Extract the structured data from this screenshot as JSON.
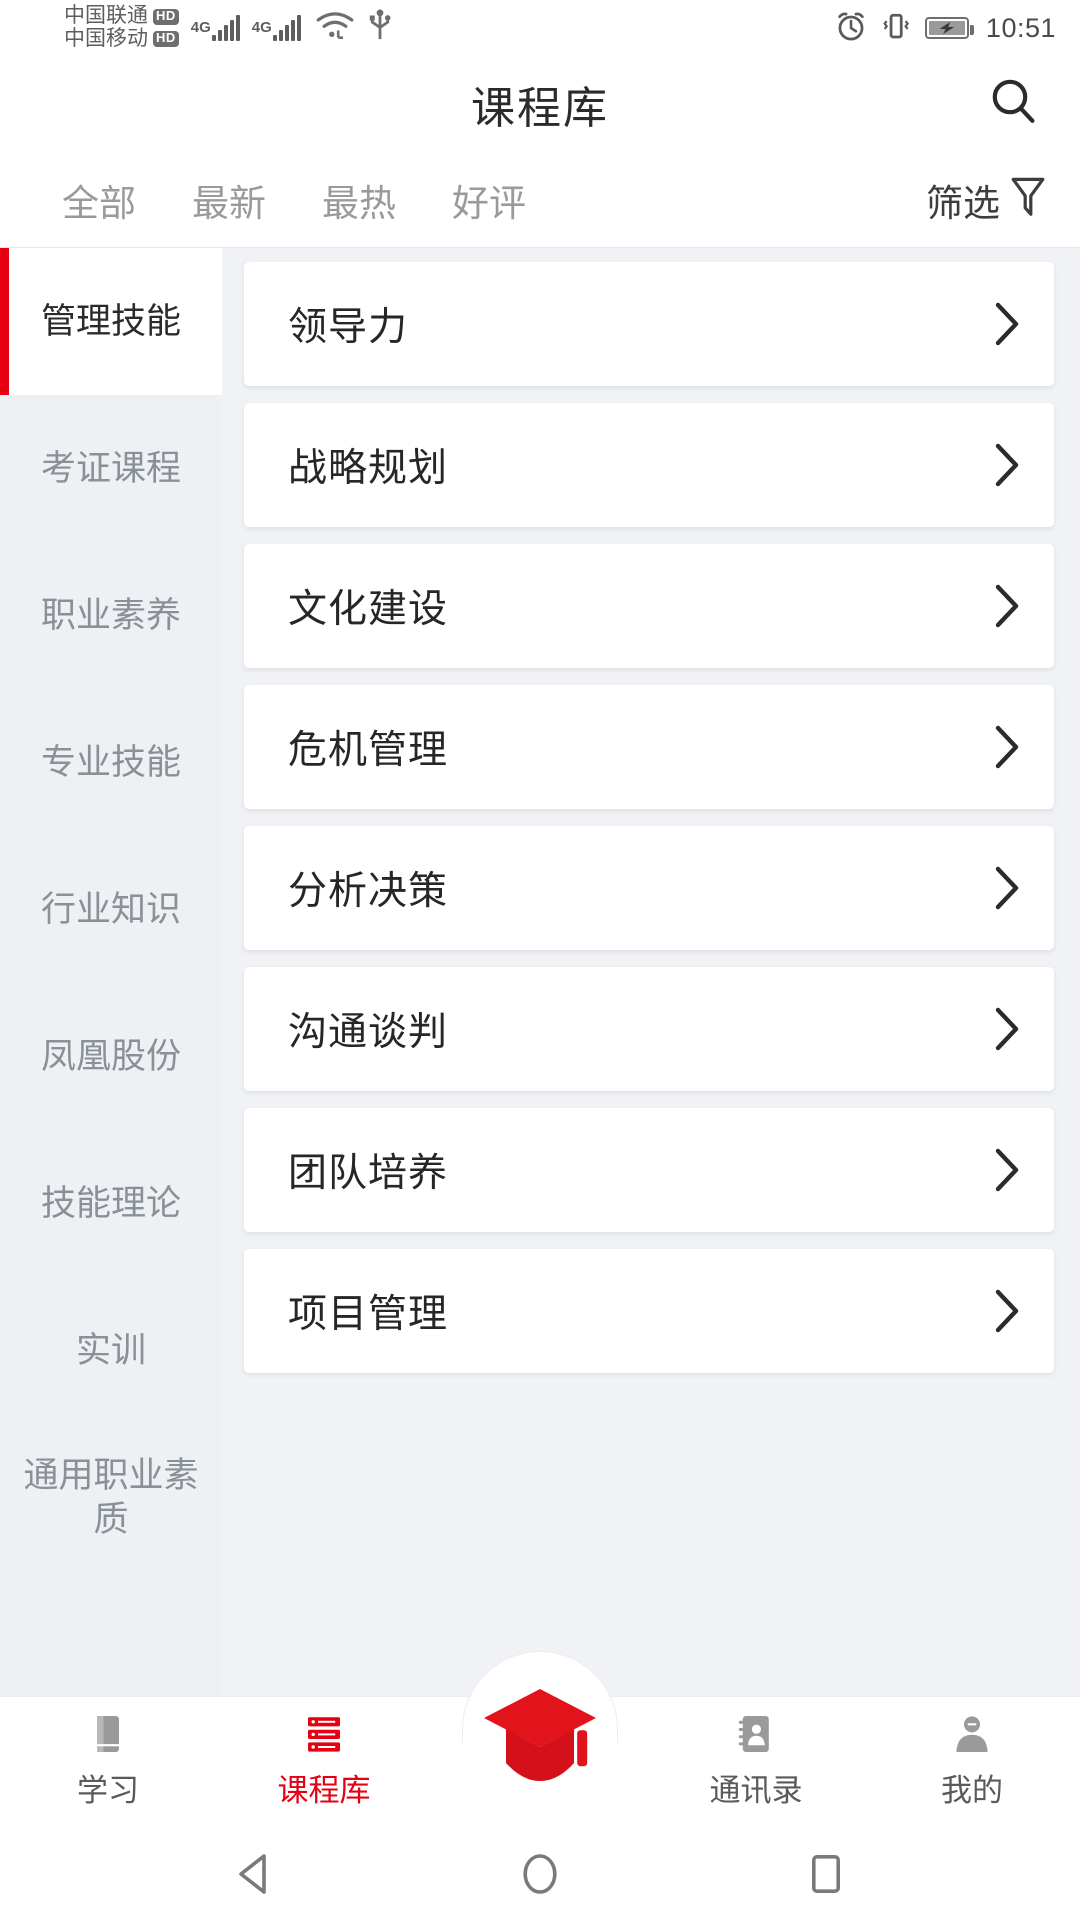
{
  "status_bar": {
    "carriers": [
      {
        "name": "中国联通",
        "badge": "HD",
        "network": "4G"
      },
      {
        "name": "中国移动",
        "badge": "HD",
        "network": "4G"
      }
    ],
    "wifi_icon": "wifi-icon",
    "usb_icon": "usb-icon",
    "alarm_icon": "alarm-clock-icon",
    "vibrate_icon": "vibrate-icon",
    "battery_icon": "battery-charging-icon",
    "time": "10:51"
  },
  "header": {
    "title": "课程库",
    "search_icon": "search-icon"
  },
  "tabs": {
    "items": [
      {
        "label": "全部",
        "active": true
      },
      {
        "label": "最新",
        "active": false
      },
      {
        "label": "最热",
        "active": false
      },
      {
        "label": "好评",
        "active": false
      }
    ],
    "filter_label": "筛选",
    "filter_icon": "funnel-icon"
  },
  "sidebar": {
    "items": [
      {
        "label": "管理技能",
        "active": true
      },
      {
        "label": "考证课程",
        "active": false
      },
      {
        "label": "职业素养",
        "active": false
      },
      {
        "label": "专业技能",
        "active": false
      },
      {
        "label": "行业知识",
        "active": false
      },
      {
        "label": "凤凰股份",
        "active": false
      },
      {
        "label": "技能理论",
        "active": false
      },
      {
        "label": "实训",
        "active": false
      },
      {
        "label": "通用职业素质",
        "active": false
      }
    ]
  },
  "course_list": {
    "items": [
      {
        "title": "领导力"
      },
      {
        "title": "战略规划"
      },
      {
        "title": "文化建设"
      },
      {
        "title": "危机管理"
      },
      {
        "title": "分析决策"
      },
      {
        "title": "沟通谈判"
      },
      {
        "title": "团队培养"
      },
      {
        "title": "项目管理"
      }
    ]
  },
  "bottom_nav": {
    "items": [
      {
        "label": "学习",
        "icon": "book-icon",
        "active": false
      },
      {
        "label": "课程库",
        "icon": "course-list-icon",
        "active": true
      },
      {
        "label": "",
        "icon": "graduation-cap-icon",
        "active": false
      },
      {
        "label": "通讯录",
        "icon": "contacts-icon",
        "active": false
      },
      {
        "label": "我的",
        "icon": "person-icon",
        "active": false
      }
    ]
  },
  "android_nav": {
    "back_icon": "back-triangle-icon",
    "home_icon": "home-circle-icon",
    "recents_icon": "recents-square-icon"
  },
  "colors": {
    "accent": "#e60012",
    "page_bg": "#f0f2f5",
    "sidebar_bg": "#eef1f4",
    "card_bg": "#ffffff",
    "text_primary": "#262626",
    "text_muted": "#8a9097"
  }
}
